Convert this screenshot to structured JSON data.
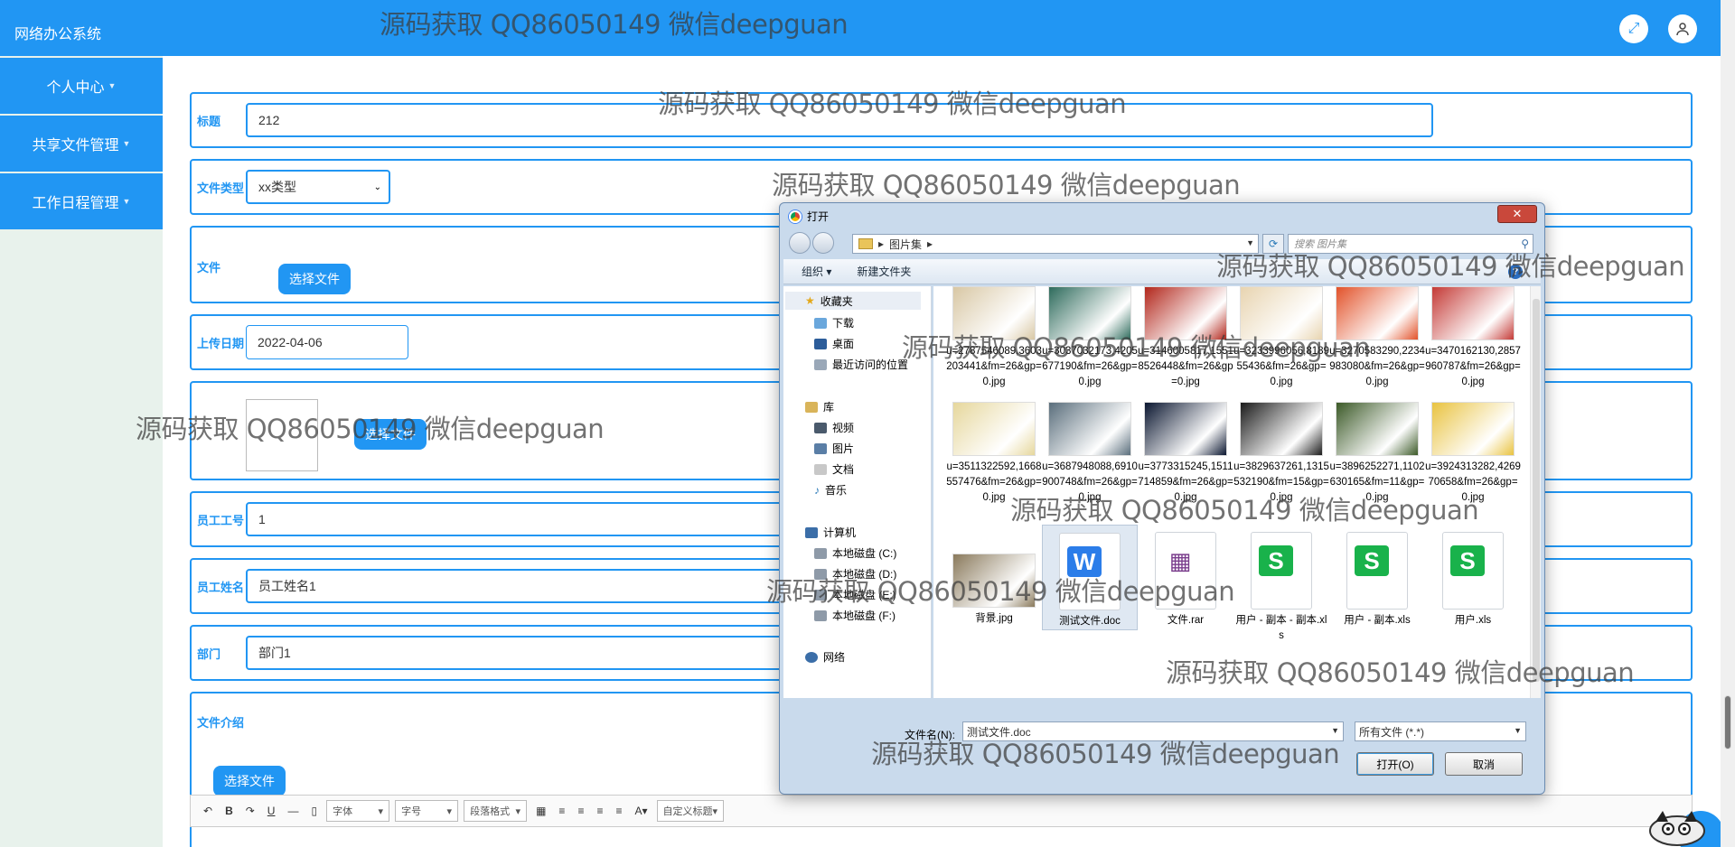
{
  "app": {
    "title": "网络办公系统"
  },
  "sidebar": {
    "items": [
      {
        "label": "个人中心"
      },
      {
        "label": "共享文件管理"
      },
      {
        "label": "工作日程管理"
      }
    ]
  },
  "form": {
    "title": {
      "label": "标题",
      "value": "212"
    },
    "file_type": {
      "label": "文件类型",
      "value": "xx类型"
    },
    "file": {
      "label": "文件",
      "button": "选择文件"
    },
    "upload_date": {
      "label": "上传日期",
      "value": "2022-04-06"
    },
    "cover": {
      "button": "选择文件"
    },
    "employee_id": {
      "label": "员工工号",
      "value": "1"
    },
    "employee_name": {
      "label": "员工姓名",
      "value": "员工姓名1"
    },
    "department": {
      "label": "部门",
      "value": "部门1"
    },
    "intro": {
      "label": "文件介绍",
      "button": "选择文件"
    }
  },
  "editor": {
    "font": "字体",
    "size": "字号",
    "paragraph": "段落格式",
    "custom_title": "自定义标题",
    "buttons": [
      "B",
      "U"
    ]
  },
  "dialog": {
    "title": "打开",
    "breadcrumb": "图片集",
    "search_placeholder": "搜索 图片集",
    "toolbar": {
      "organize": "组织 ▾",
      "new_folder": "新建文件夹"
    },
    "nav": {
      "favorites": "收藏夹",
      "downloads": "下载",
      "desktop": "桌面",
      "recent": "最近访问的位置",
      "libraries": "库",
      "videos": "视频",
      "pictures": "图片",
      "documents": "文档",
      "music": "音乐",
      "computer": "计算机",
      "disk_c": "本地磁盘 (C:)",
      "disk_d": "本地磁盘 (D:)",
      "disk_e": "本地磁盘 (E:)",
      "disk_f": "本地磁盘 (F:)",
      "network": "网络"
    },
    "files": [
      {
        "name": "u=2787546089,3603203441&fm=26&gp=0.jpg",
        "color": "#d8c7a4"
      },
      {
        "name": "u=3037032173,4205677190&fm=26&gp=0.jpg",
        "color": "#2e6b5c"
      },
      {
        "name": "u=3146005817,15518526448&fm=26&gp=0.jpg",
        "color": "#b2261b"
      },
      {
        "name": "u=3233996056,818955436&fm=26&gp=0.jpg",
        "color": "#e8d4b0"
      },
      {
        "name": "u=3270583290,2234983080&fm=26&gp=0.jpg",
        "color": "#e2522a"
      },
      {
        "name": "u=3470162130,2857960787&fm=26&gp=0.jpg",
        "color": "#c43a36"
      },
      {
        "name": "u=3511322592,1668557476&fm=26&gp=0.jpg",
        "color": "#e6d79c"
      },
      {
        "name": "u=3687948088,6910900748&fm=26&gp=0.jpg",
        "color": "#5a6e7c"
      },
      {
        "name": "u=3773315245,1511714859&fm=26&gp=0.jpg",
        "color": "#0a1630"
      },
      {
        "name": "u=3829637261,1315532190&fm=15&gp=0.jpg",
        "color": "#1b1b1b"
      },
      {
        "name": "u=3896252271,1102630165&fm=11&gp=0.jpg",
        "color": "#3c5a28"
      },
      {
        "name": "u=3924313282,426970658&fm=26&gp=0.jpg",
        "color": "#e9c341"
      },
      {
        "name": "背景.jpg",
        "color": "#8a7a5c"
      },
      {
        "name": "测试文件.doc",
        "color": "#2b7de9"
      },
      {
        "name": "文件.rar",
        "color": "#7a3d8c"
      },
      {
        "name": "用户 - 副本 - 副本.xls",
        "color": "#19b24b"
      },
      {
        "name": "用户 - 副本.xls",
        "color": "#19b24b"
      },
      {
        "name": "用户.xls",
        "color": "#19b24b"
      }
    ],
    "filename_label": "文件名(N):",
    "filename_value": "测试文件.doc",
    "filetype_value": "所有文件 (*.*)",
    "open_button": "打开(O)",
    "cancel_button": "取消"
  },
  "watermark": "源码获取 QQ86050149 微信deepguan"
}
